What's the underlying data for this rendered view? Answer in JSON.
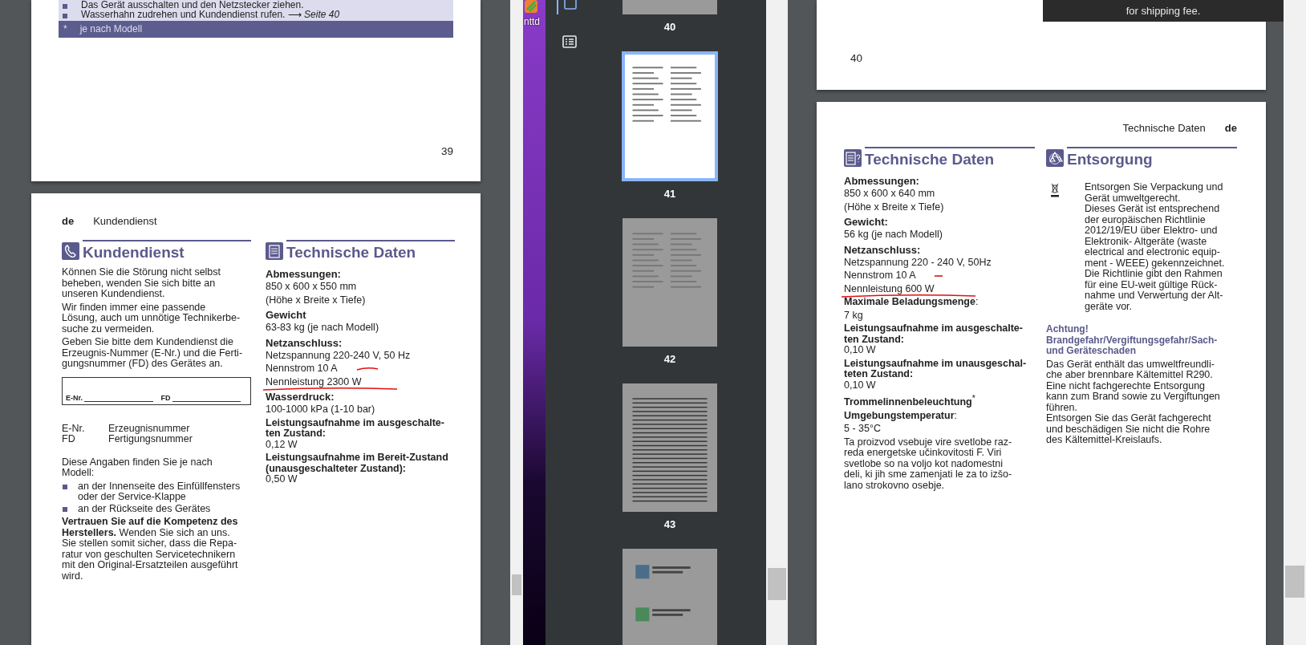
{
  "left_viewer": {
    "page_end": {
      "box_lines": [
        {
          "text": "Das Gerät ausschalten und den Netzstecker ziehen."
        },
        {
          "text": "Wasserhahn zudrehen und Kundendienst rufen. ⟶ *Seite 40*"
        }
      ],
      "footnote": {
        "mark": "*",
        "text": "je nach Modell"
      },
      "page_number": "39"
    },
    "page": {
      "header": {
        "lang": "de",
        "title": "Kundendienst",
        "kind": "left"
      },
      "columns": [
        {
          "heading": {
            "kind": "phone",
            "title": "Kundendienst"
          },
          "blocks": [
            {
              "kind": "para",
              "lines": [
                "Können Sie die Störung nicht selbst",
                "beheben, wenden Sie sich bitte an",
                "unseren Kundendienst."
              ]
            },
            {
              "kind": "para",
              "lines": [
                "Wir finden immer eine passende",
                "Lösung, auch um unnötige Technikerbe-",
                "suche zu vermeiden."
              ]
            },
            {
              "kind": "para",
              "lines": [
                "Geben Sie bitte dem Kundendienst die",
                "Erzeugnis-Nummer (E-Nr.) und die Ferti-",
                "gungsnummer (FD) des Gerätes an."
              ]
            },
            {
              "kind": "form",
              "fields": [
                "E-Nr.",
                "FD"
              ]
            },
            {
              "kind": "defs",
              "rows": [
                {
                  "term": "E-Nr.",
                  "desc": "Erzeugnisnummer"
                },
                {
                  "term": "FD",
                  "desc": "Fertigungsnummer"
                }
              ]
            },
            {
              "kind": "para",
              "lines": [
                "Diese Angaben finden Sie je nach",
                "Modell:"
              ]
            },
            {
              "kind": "bullets",
              "items": [
                {
                  "lines": [
                    "an der Innenseite des Einfüllfensters",
                    "oder der Service-Klappe"
                  ]
                },
                {
                  "lines": [
                    "an der Rückseite des Gerätes"
                  ]
                }
              ]
            },
            {
              "kind": "para",
              "lines": [
                "**Vertrauen Sie auf die Kompetenz des**",
                "**Herstellers.** Wenden Sie sich an uns.",
                "Sie stellen somit sicher, dass die Repa-",
                "ratur von geschulten Servicetechnikern",
                "mit den Original-Ersatzteilen ausgeführt",
                "wird."
              ]
            }
          ]
        },
        {
          "heading": {
            "kind": "document",
            "title": "Technische Daten"
          },
          "blocks": [
            {
              "kind": "term",
              "text": "Abmessungen:"
            },
            {
              "kind": "value",
              "text": "850 x 600 x 550 mm"
            },
            {
              "kind": "value",
              "text": "(Höhe x Breite x Tiefe)"
            },
            {
              "kind": "term",
              "text": "Gewicht"
            },
            {
              "kind": "value",
              "text": "63-83 kg (je nach Modell)"
            },
            {
              "kind": "term",
              "text": "Netzanschluss:"
            },
            {
              "kind": "value",
              "text": "Netzspannung 220-240 V, 50 Hz"
            },
            {
              "kind": "value",
              "text": "Nennstrom 10 A",
              "annotation": {
                "kind": "curve"
              }
            },
            {
              "kind": "value",
              "text": "Nennleistung 2300 W",
              "annotation": {
                "kind": "underline"
              }
            },
            {
              "kind": "term",
              "text": "Wasserdruck:"
            },
            {
              "kind": "value",
              "text": "100-1000 kPa (1-10 bar)"
            },
            {
              "kind": "para",
              "lines": [
                "**Leistungsaufnahme im ausgeschalte-**",
                "**ten Zustand:**",
                "0,12 W"
              ]
            },
            {
              "kind": "para",
              "lines": [
                "**Leistungsaufnahme im Bereit-Zustand**",
                "**(unausgeschalteter Zustand):**",
                "0,50 W"
              ]
            }
          ]
        }
      ]
    }
  },
  "desktop": {
    "icon_label": "nttd"
  },
  "sidebar": {
    "tools": [
      {
        "kind": "thumbnails",
        "selected": true
      },
      {
        "kind": "outline",
        "selected": false
      }
    ],
    "thumbnails": [
      {
        "label": "40",
        "kind": "text",
        "selected": false
      },
      {
        "label": "41",
        "kind": "text",
        "selected": true
      },
      {
        "label": "42",
        "kind": "text",
        "selected": false
      },
      {
        "label": "43",
        "kind": "lined",
        "selected": false
      },
      {
        "kind": "brochure",
        "selected": false
      }
    ]
  },
  "right_viewer": {
    "page_end": {
      "page_number": "40"
    },
    "toast": {
      "text": "for shipping fee."
    },
    "page": {
      "header": {
        "lang": "de",
        "title": "Technische Daten",
        "kind": "right"
      },
      "columns": [
        {
          "heading": {
            "kind": "document-question",
            "title": "Technische Daten"
          },
          "blocks": [
            {
              "kind": "term",
              "text": "Abmessungen:"
            },
            {
              "kind": "value",
              "text": "850 x 600 x 640 mm"
            },
            {
              "kind": "value",
              "text": "(Höhe x Breite x Tiefe)"
            },
            {
              "kind": "term",
              "text": "Gewicht:"
            },
            {
              "kind": "value",
              "text": "56 kg (je nach Modell)"
            },
            {
              "kind": "term",
              "text": "Netzanschluss:"
            },
            {
              "kind": "value",
              "text": "Netzspannung 220 - 240 V, 50Hz"
            },
            {
              "kind": "value",
              "text": "Nennstrom 10 A",
              "annotation": {
                "kind": "dash"
              }
            },
            {
              "kind": "value",
              "text": "Nennleistung 600 W",
              "annotation": {
                "kind": "underline"
              }
            },
            {
              "kind": "para",
              "lines": [
                "**Maximale Beladungsmenge**:"
              ]
            },
            {
              "kind": "value",
              "text": "7 kg"
            },
            {
              "kind": "para",
              "lines": [
                "**Leistungsaufnahme im ausgeschalte-**",
                "**ten Zustand:**",
                "0,10 W"
              ]
            },
            {
              "kind": "para",
              "lines": [
                "**Leistungsaufnahme im unausgeschal-**",
                "**teten Zustand:**",
                "0,10 W"
              ]
            },
            {
              "kind": "para",
              "lines": [
                "**Trommelinnenbeleuchtung**$^{*}$"
              ]
            },
            {
              "kind": "para",
              "lines": [
                "**Umgebungstemperatur**:"
              ]
            },
            {
              "kind": "value",
              "text": "5 - 35°C"
            },
            {
              "kind": "para",
              "lines": [
                "Ta proizvod vsebuje vire svetlobe raz-",
                "reda energetske učinkovitosti F. Viri",
                "svetlobe so na voljo kot nadomestni",
                "deli, ki jih sme zamenjati le za to izšo-",
                "lano strokovno osebje."
              ]
            }
          ]
        },
        {
          "heading": {
            "kind": "recycle",
            "title": "Entsorgung"
          },
          "blocks": [
            {
              "kind": "weee",
              "lines": [
                "Entsorgen Sie Verpackung und",
                "Gerät umweltgerecht.",
                "Dieses Gerät ist entsprechend",
                "der europäischen Richtlinie",
                "2012/19/EU über Elektro- und",
                "Elektronik- Altgeräte (waste",
                "electrical and electronic equip-",
                "ment - WEEE) gekennzeichnet.",
                "Die Richtlinie gibt den Rahmen",
                "für eine EU-weit gültige Rück-",
                "nahme und Verwertung der Alt-",
                "geräte vor."
              ]
            },
            {
              "kind": "alert",
              "lines": [
                "Achtung!",
                "Brandgefahr/Vergiftungsgefahr/Sach-",
                "und Geräteschaden"
              ]
            },
            {
              "kind": "para",
              "lines": [
                "Das Gerät enthält das umweltfreundli-",
                "che aber brennbare Kältemittel R290.",
                "Eine nicht fachgerechte Entsorgung",
                "kann zum Brand sowie zu Vergiftungen",
                "führen.",
                "Entsorgen Sie das Gerät fachgerecht",
                "und beschädigen Sie nicht die Rohre",
                "des Kältemittel-Kreislaufs."
              ]
            }
          ]
        }
      ]
    }
  }
}
